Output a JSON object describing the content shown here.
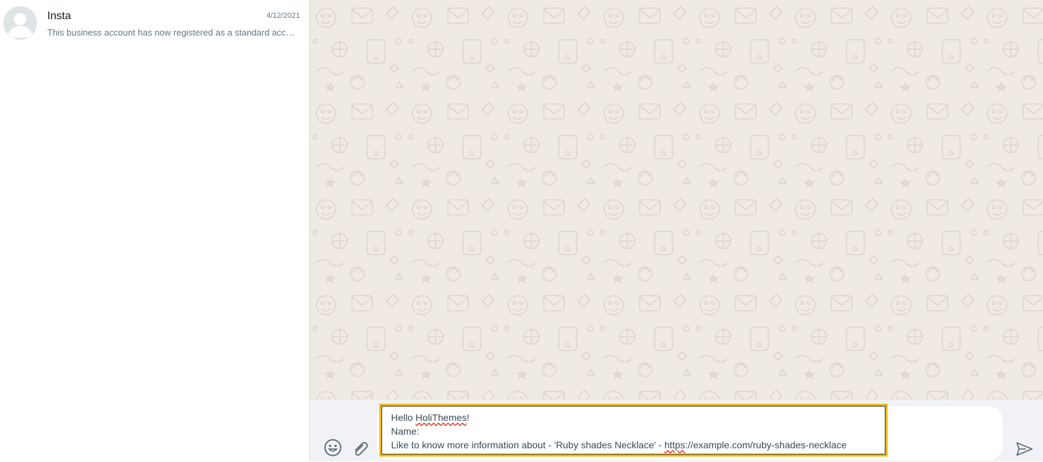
{
  "chat_list": {
    "items": [
      {
        "name": "Insta",
        "date": "4/12/2021",
        "preview": "This business account has now registered as a standard account."
      }
    ]
  },
  "composer": {
    "greeting_prefix": "Hello ",
    "greeting_name": "HoliThemes",
    "greeting_suffix": "!",
    "name_line": "Name:",
    "info_prefix": "Like to know more information about - 'Ruby shades Necklace' - ",
    "url_scheme": "https",
    "url_rest": "://example.com/ruby-shades-necklace"
  },
  "icons": {
    "emoji": "smiley-icon",
    "attach": "paperclip-icon",
    "send": "send-icon",
    "avatar": "default-avatar-icon"
  },
  "colors": {
    "wallpaper": "#efeae2",
    "footer": "#f0f2f5",
    "highlight": "#f2b600"
  }
}
